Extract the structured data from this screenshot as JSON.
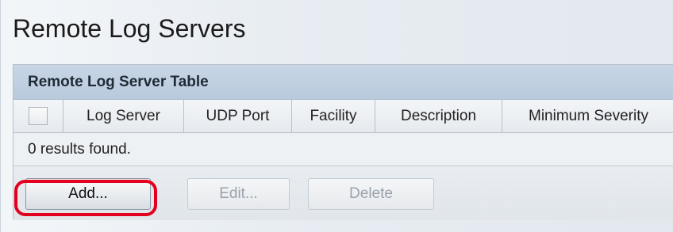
{
  "page": {
    "title": "Remote Log Servers"
  },
  "table": {
    "title": "Remote Log Server Table",
    "columns": [
      "Log Server",
      "UDP Port",
      "Facility",
      "Description",
      "Minimum Severity"
    ],
    "results_text": "0 results found.",
    "rows": []
  },
  "buttons": {
    "add_label": "Add...",
    "edit_label": "Edit...",
    "delete_label": "Delete",
    "edit_disabled": true,
    "delete_disabled": true
  },
  "annotation": {
    "highlight_color": "#e3001f",
    "highlight_target": "add-button"
  }
}
